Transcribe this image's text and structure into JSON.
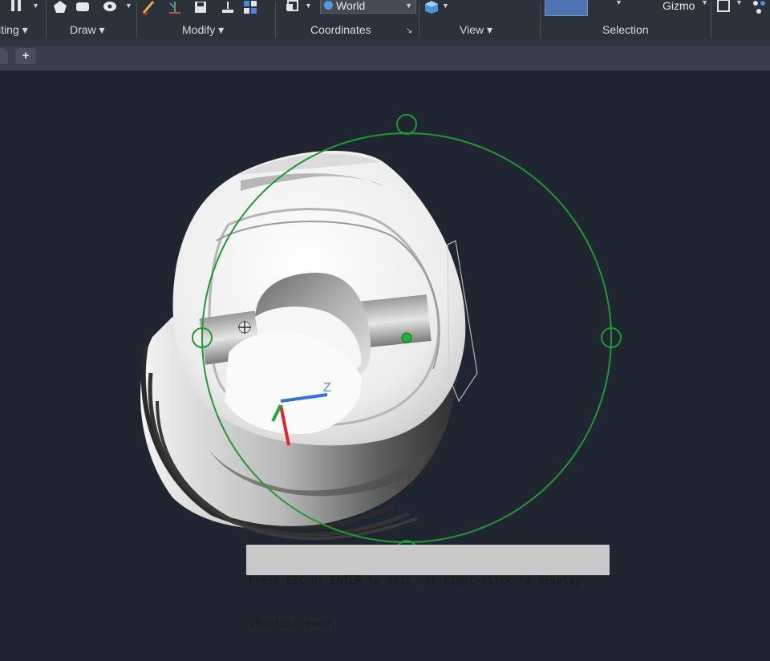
{
  "ribbon": {
    "panels": [
      {
        "label": "iting ▾"
      },
      {
        "label": "Draw ▾"
      },
      {
        "label": "Modify ▾"
      },
      {
        "label": "Coordinates"
      },
      {
        "label": "View ▾"
      },
      {
        "label": "Selection"
      }
    ],
    "coordinates_launcher": "↘",
    "ucs_dropdown_value": "World",
    "gizmo_label": "Gizmo"
  },
  "tabs": {
    "new_tab_label": "+"
  },
  "viewport": {
    "ucs_z_label": "Z",
    "colors": {
      "background": "#1f2632",
      "gizmo_green": "#1f9a33",
      "ucs_x": "#e0262c",
      "ucs_y": "#21a83b",
      "ucs_z": "#2f73d8"
    }
  },
  "command_line": {
    "prompt_line1": "Press ESC or ENTER to exit, or right-click to display",
    "prompt_line2": "shortcut-menu."
  }
}
